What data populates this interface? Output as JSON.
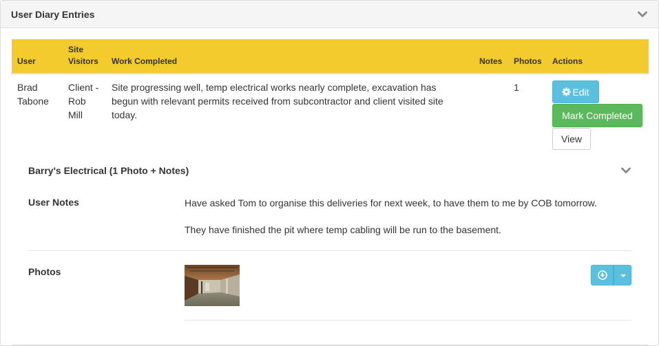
{
  "panel": {
    "title": "User Diary Entries"
  },
  "table": {
    "headers": {
      "user": "User",
      "site_visitors_line1": "Site",
      "site_visitors_line2": "Visitors",
      "work_completed": "Work Completed",
      "notes": "Notes",
      "photos": "Photos",
      "actions": "Actions"
    },
    "row": {
      "user_line1": "Brad",
      "user_line2": "Tabone",
      "visitors_line1": "Client -",
      "visitors_line2": "Rob",
      "visitors_line3": "Mill",
      "work_line1": "Site progressing well, temp electrical works nearly complete, excavation has",
      "work_line2": "begun with relevant permits received from subcontractor and client visited site",
      "work_line3": "today.",
      "notes": "",
      "photos": "1"
    },
    "actions": {
      "edit_label": "Edit",
      "mark_completed_label": "Mark Completed",
      "view_label": "View"
    }
  },
  "subentry": {
    "heading": "Barry's Electrical (1 Photo + Notes)",
    "user_notes_label": "User Notes",
    "note_line1": "Have asked Tom to organise this deliveries for next week, to have them to me by COB tomorrow.",
    "note_line2": "They have finished the pit where temp cabling will be run to the basement.",
    "photos_label": "Photos"
  },
  "colors": {
    "header_yellow": "#f4cb2d",
    "info_blue": "#5bc0de",
    "success_green": "#5cb85c"
  },
  "icons": {
    "collapse": "chevron-down-icon",
    "edit": "gear-icon",
    "download": "download-circle-icon",
    "dropdown": "caret-down-icon"
  }
}
